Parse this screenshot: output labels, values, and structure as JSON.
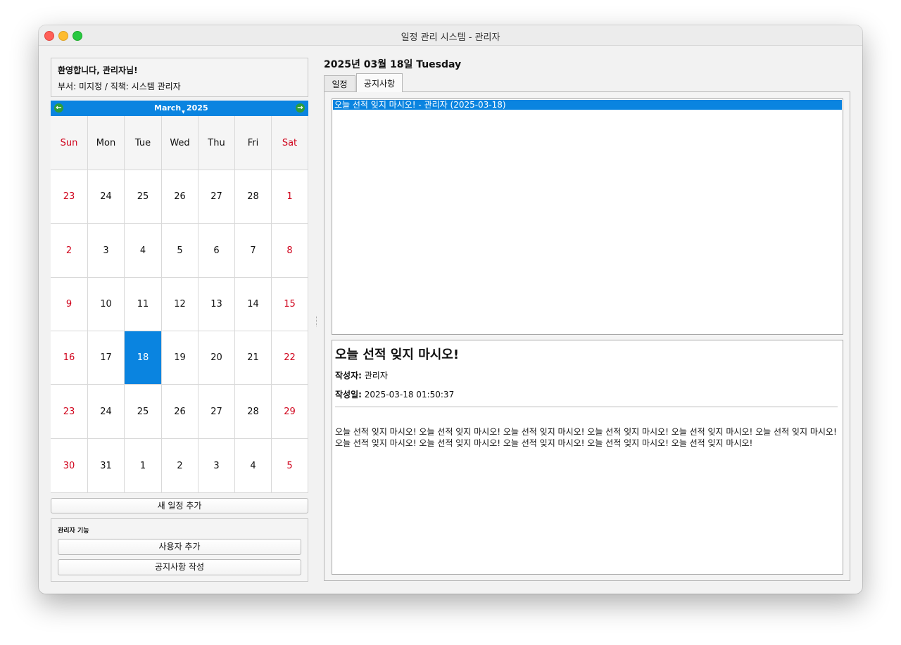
{
  "window": {
    "title": "일정 관리 시스템 - 관리자"
  },
  "welcome": {
    "greeting": "환영합니다, 관리자님!",
    "info": "부서: 미지정 / 직책: 시스템 관리자"
  },
  "calendar": {
    "month": "March",
    "year": "2025",
    "selected_day": "18",
    "weekdays": [
      "Sun",
      "Mon",
      "Tue",
      "Wed",
      "Thu",
      "Fri",
      "Sat"
    ],
    "weeks": [
      [
        "23",
        "24",
        "25",
        "26",
        "27",
        "28",
        "1"
      ],
      [
        "2",
        "3",
        "4",
        "5",
        "6",
        "7",
        "8"
      ],
      [
        "9",
        "10",
        "11",
        "12",
        "13",
        "14",
        "15"
      ],
      [
        "16",
        "17",
        "18",
        "19",
        "20",
        "21",
        "22"
      ],
      [
        "23",
        "24",
        "25",
        "26",
        "27",
        "28",
        "29"
      ],
      [
        "30",
        "31",
        "1",
        "2",
        "3",
        "4",
        "5"
      ]
    ],
    "weekend_color": "#d0021b",
    "accent": "#0a84e0"
  },
  "buttons": {
    "add_schedule": "새 일정 추가"
  },
  "admin": {
    "title": "관리자 기능",
    "add_user": "사용자 추가",
    "write_notice": "공지사항 작성"
  },
  "main": {
    "date_header": "2025년 03월 18일 Tuesday",
    "tabs": [
      {
        "label": "일정"
      },
      {
        "label": "공지사항"
      }
    ],
    "active_tab": "공지사항"
  },
  "notices": {
    "items": [
      {
        "label": "오늘 선적 잊지 마시오! - 관리자 (2025-03-18)"
      }
    ]
  },
  "notice_detail": {
    "title": "오늘 선적 잊지 마시오!",
    "author_label": "작성자:",
    "author": "관리자",
    "date_label": "작성일:",
    "date": "2025-03-18 01:50:37",
    "body_line1": "오늘 선적 잊지 마시오! 오늘 선적 잊지 마시오! 오늘 선적 잊지 마시오! 오늘 선적 잊지 마시오! 오늘 선적 잊지 마시오! 오늘 선적 잊지 마시오!",
    "body_line2": "오늘 선적 잊지 마시오! 오늘 선적 잊지 마시오! 오늘 선적 잊지 마시오! 오늘 선적 잊지 마시오! 오늘 선적 잊지 마시오!"
  }
}
